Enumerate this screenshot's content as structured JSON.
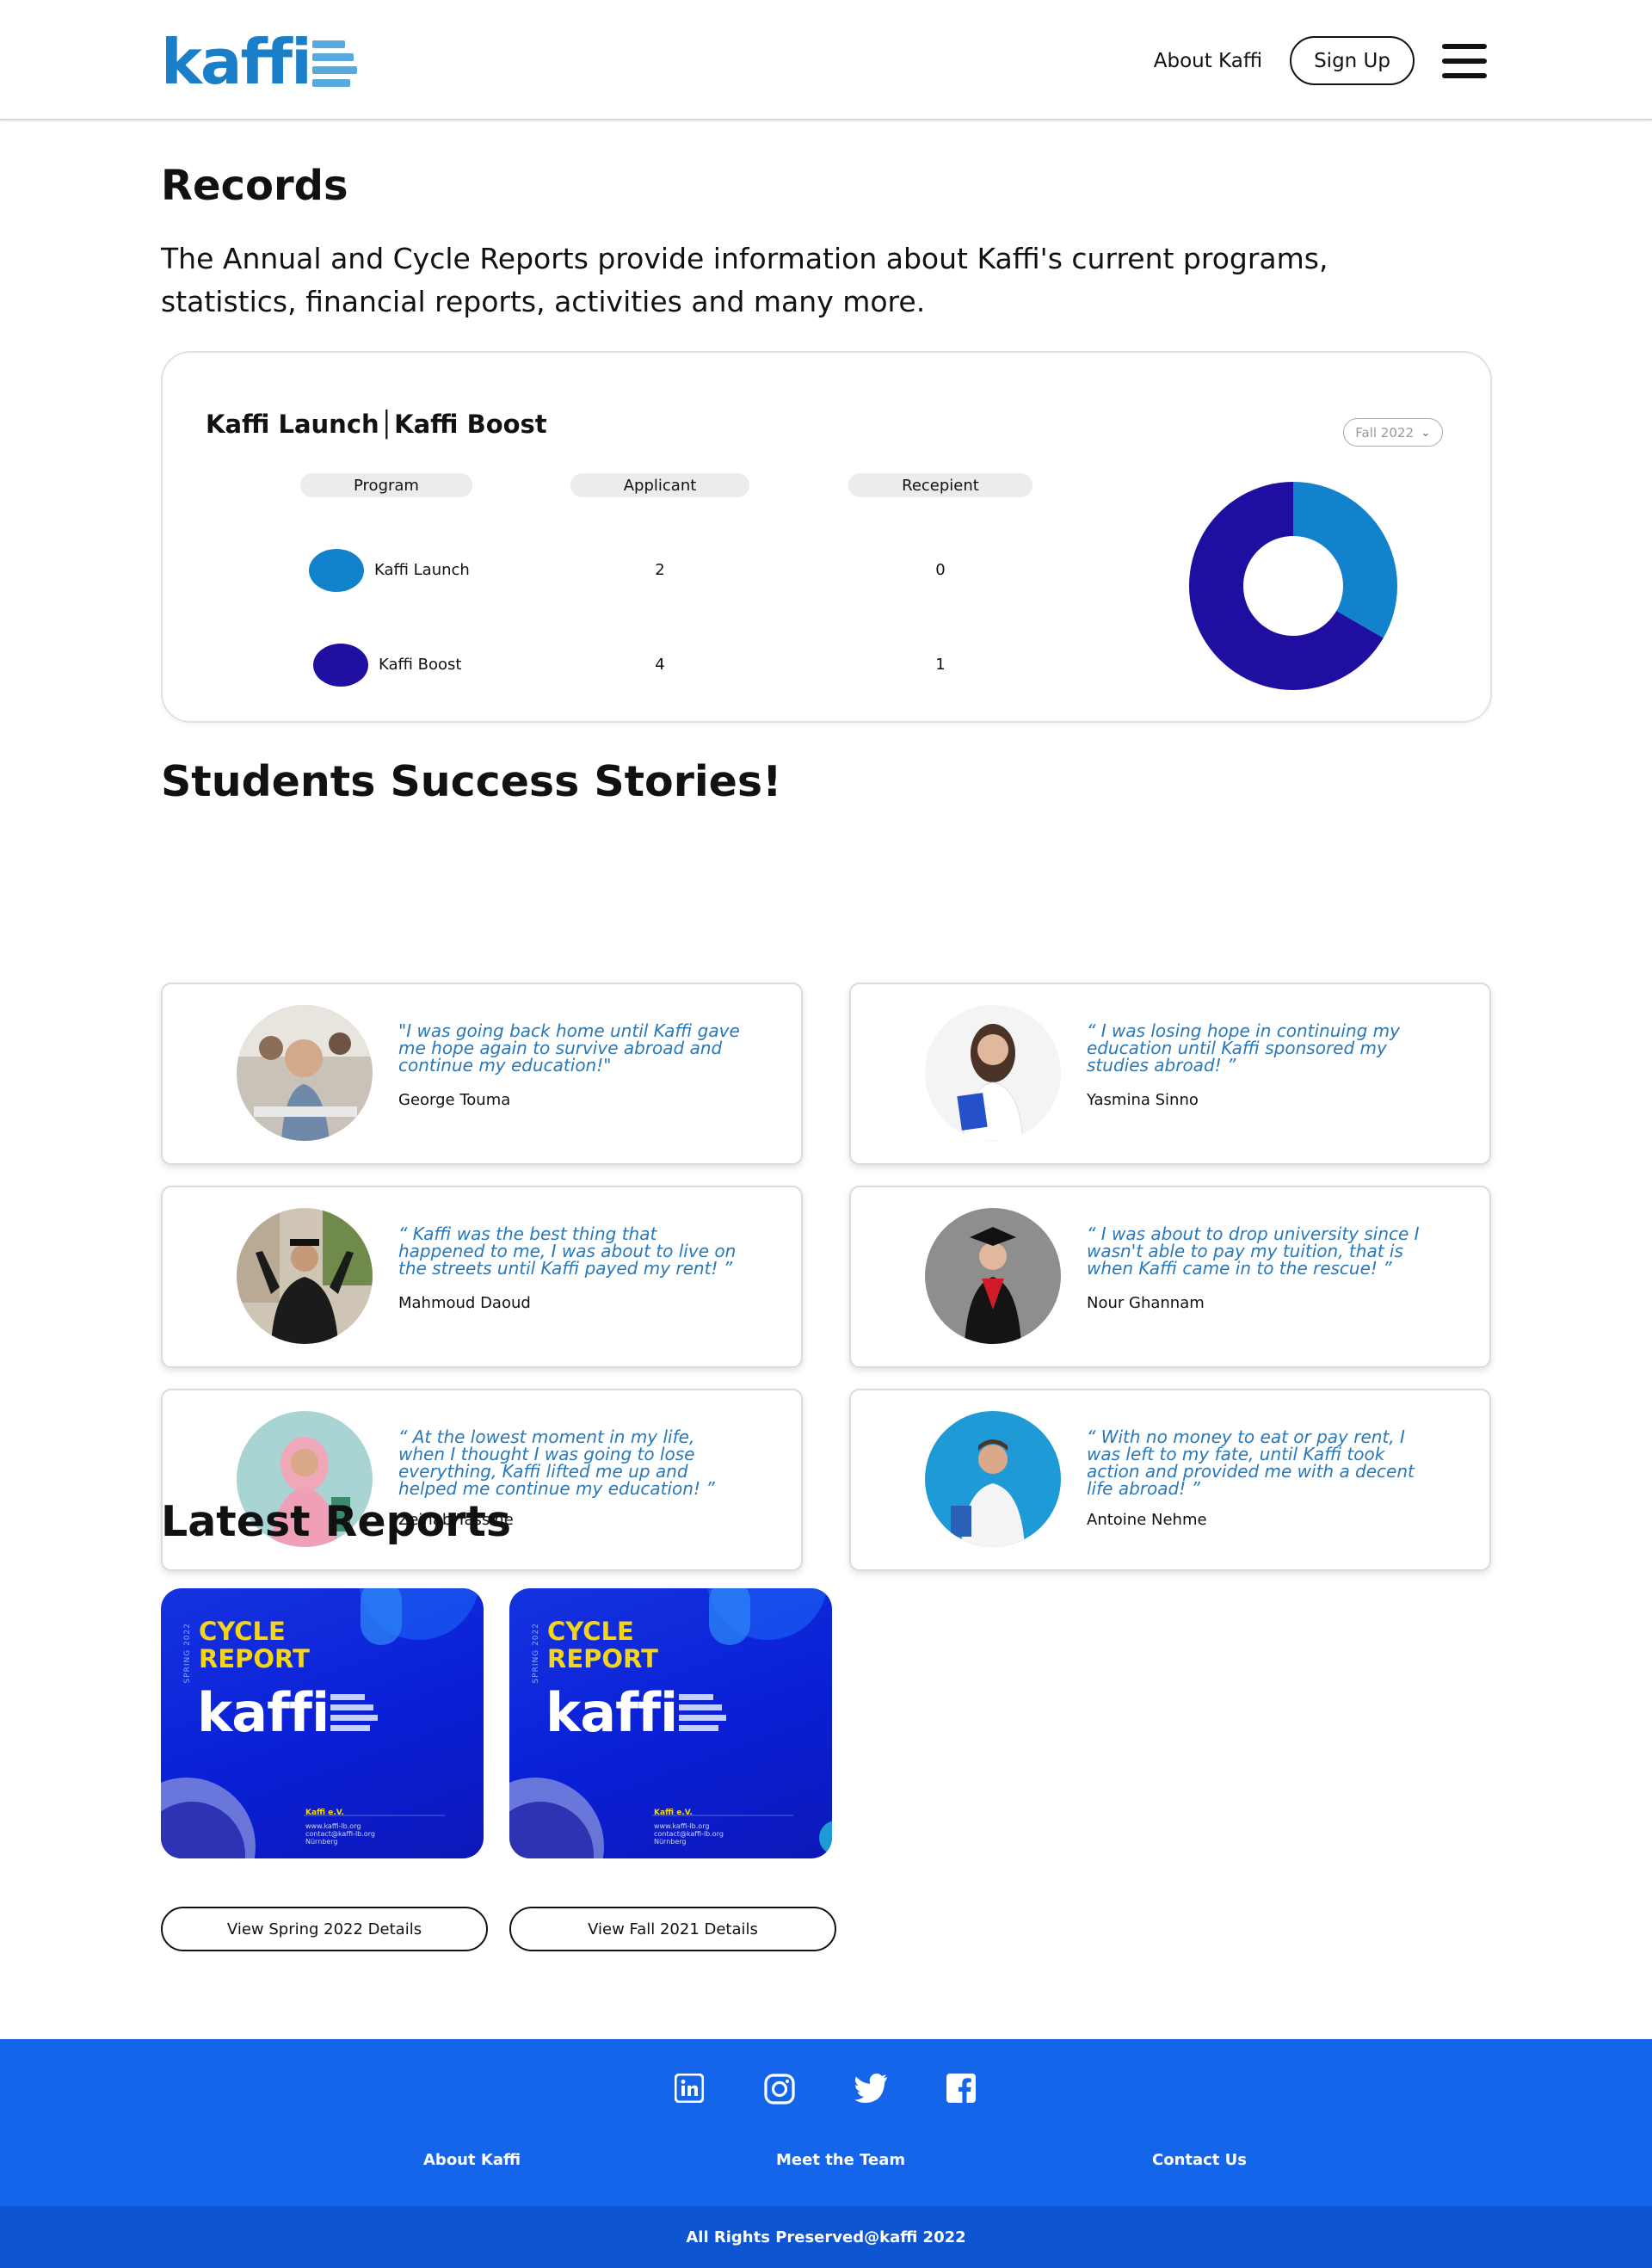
{
  "header": {
    "logo_text": "kaffi",
    "nav_about": "About Kaffi",
    "signup_label": "Sign Up",
    "menu_icon": "hamburger-menu-icon"
  },
  "records": {
    "title": "Records",
    "description": "The Annual and Cycle Reports provide information about Kaffi's current programs, statistics, financial reports, activities and many more.",
    "card_title": "Kaffi Launch│Kaffi Boost",
    "term_select": "Fall 2022",
    "columns": [
      "Program",
      "Applicant",
      "Recepient"
    ],
    "rows": [
      {
        "program": "Kaffi Launch",
        "applicant": "2",
        "recipient": "0",
        "color": "#1282cc"
      },
      {
        "program": "Kaffi Boost",
        "applicant": "4",
        "recipient": "1",
        "color": "#1e0fa0"
      }
    ],
    "chart_data": {
      "type": "pie",
      "style": "donut",
      "categories": [
        "Kaffi Launch",
        "Kaffi Boost"
      ],
      "values": [
        2,
        4
      ],
      "colors": [
        "#1282cc",
        "#1e0fa0"
      ]
    }
  },
  "stories": {
    "title": "Students Success Stories!",
    "items": [
      {
        "quote": "\"I was going back home until Kaffi gave me hope again to survive abroad and continue my education!\"",
        "name": "George Touma"
      },
      {
        "quote": "“ I was losing hope in continuing my education until Kaffi sponsored my studies abroad! ”",
        "name": "Yasmina Sinno"
      },
      {
        "quote": "“ Kaffi was the best thing that happened to me, I was about to live on the streets until Kaffi payed my rent! ”",
        "name": "Mahmoud Daoud"
      },
      {
        "quote": "“ I was about to drop university since I wasn't able to pay my tuition, that is when Kaffi came in to the rescue! ”",
        "name": "Nour Ghannam"
      },
      {
        "quote": "“ At the lowest moment in my life, when I thought I was going to lose everything, Kaffi lifted me up and helped me continue my education! ”",
        "name": "Zeinab Yassine"
      },
      {
        "quote": "“ With no money to eat or pay rent, I was left to my fate, until Kaffi took action and provided me with a decent life abroad! ”",
        "name": "Antoine Nehme"
      }
    ]
  },
  "reports": {
    "title": "Latest Reports",
    "thumb": {
      "season": "SPRING 2022",
      "heading_line1": "CYCLE",
      "heading_line2": "REPORT",
      "logo": "kaffi",
      "org": "Kaffi e.V.",
      "website": "www.kaffi-lb.org",
      "email": "contact@kaffi-lb.org",
      "city": "Nürnberg"
    },
    "buttons": [
      "View Spring 2022 Details",
      "View Fall 2021 Details"
    ]
  },
  "footer": {
    "social_icons": [
      "linkedin-icon",
      "instagram-icon",
      "twitter-icon",
      "facebook-icon"
    ],
    "links": [
      "About Kaffi",
      "Meet the Team",
      "Contact Us"
    ],
    "copyright": "All Rights Preserved@kaffi 2022"
  }
}
